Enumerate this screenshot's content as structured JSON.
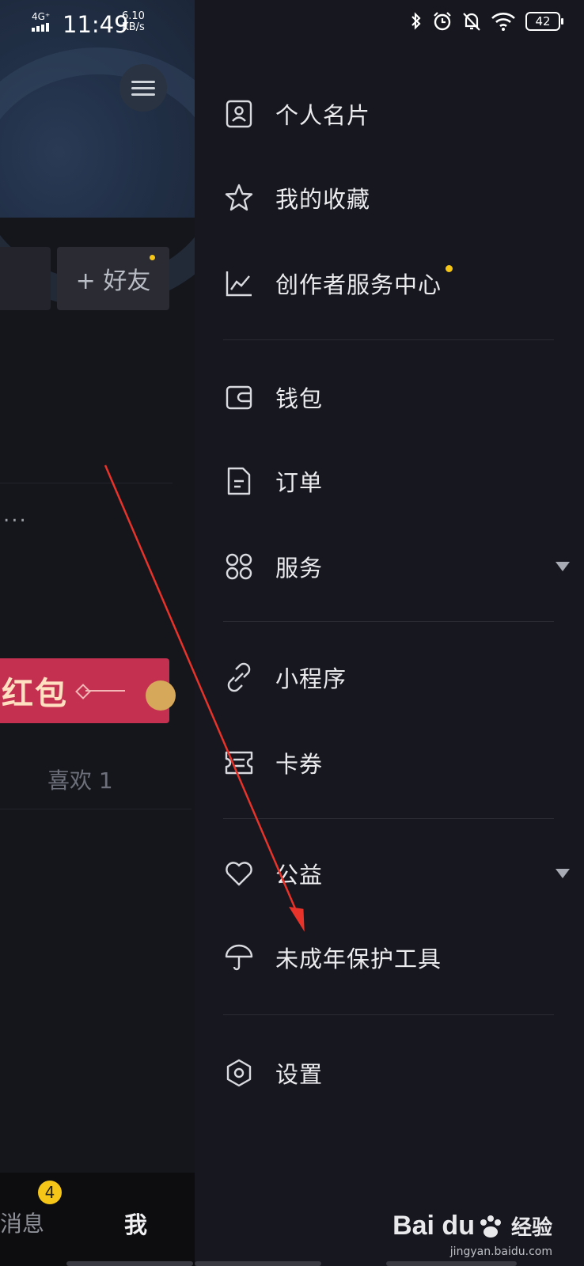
{
  "status_bar": {
    "network": "4G⁺",
    "time": "11:49",
    "speed_value": "6.10",
    "speed_unit": "KB/s",
    "battery": "42"
  },
  "profile_behind": {
    "add_friend": "+ 好友",
    "ellipsis": "...",
    "banner_text": "红包",
    "likes_label": "喜欢 1",
    "nav_messages": "消息",
    "nav_messages_badge": "4",
    "nav_me": "我"
  },
  "drawer": {
    "group1": [
      {
        "label": "个人名片",
        "icon": "id-card-icon"
      },
      {
        "label": "我的收藏",
        "icon": "star-icon"
      },
      {
        "label": "创作者服务中心",
        "icon": "chart-line-icon",
        "dot": true
      }
    ],
    "group2": [
      {
        "label": "钱包",
        "icon": "wallet-icon"
      },
      {
        "label": "订单",
        "icon": "document-icon"
      },
      {
        "label": "服务",
        "icon": "grid-icon",
        "expandable": true
      }
    ],
    "group3": [
      {
        "label": "小程序",
        "icon": "mini-program-icon"
      },
      {
        "label": "卡券",
        "icon": "ticket-icon"
      }
    ],
    "group4": [
      {
        "label": "公益",
        "icon": "heart-icon",
        "expandable": true
      },
      {
        "label": "未成年保护工具",
        "icon": "umbrella-icon"
      }
    ],
    "group5": [
      {
        "label": "设置",
        "icon": "gear-icon"
      }
    ]
  },
  "watermark": {
    "brand": "Bai du",
    "suffix": "经验",
    "site": "jingyan.baidu.com"
  },
  "colors": {
    "accent_dot": "#f5c518",
    "annotation_arrow": "#e8332a",
    "banner": "#c43150"
  }
}
